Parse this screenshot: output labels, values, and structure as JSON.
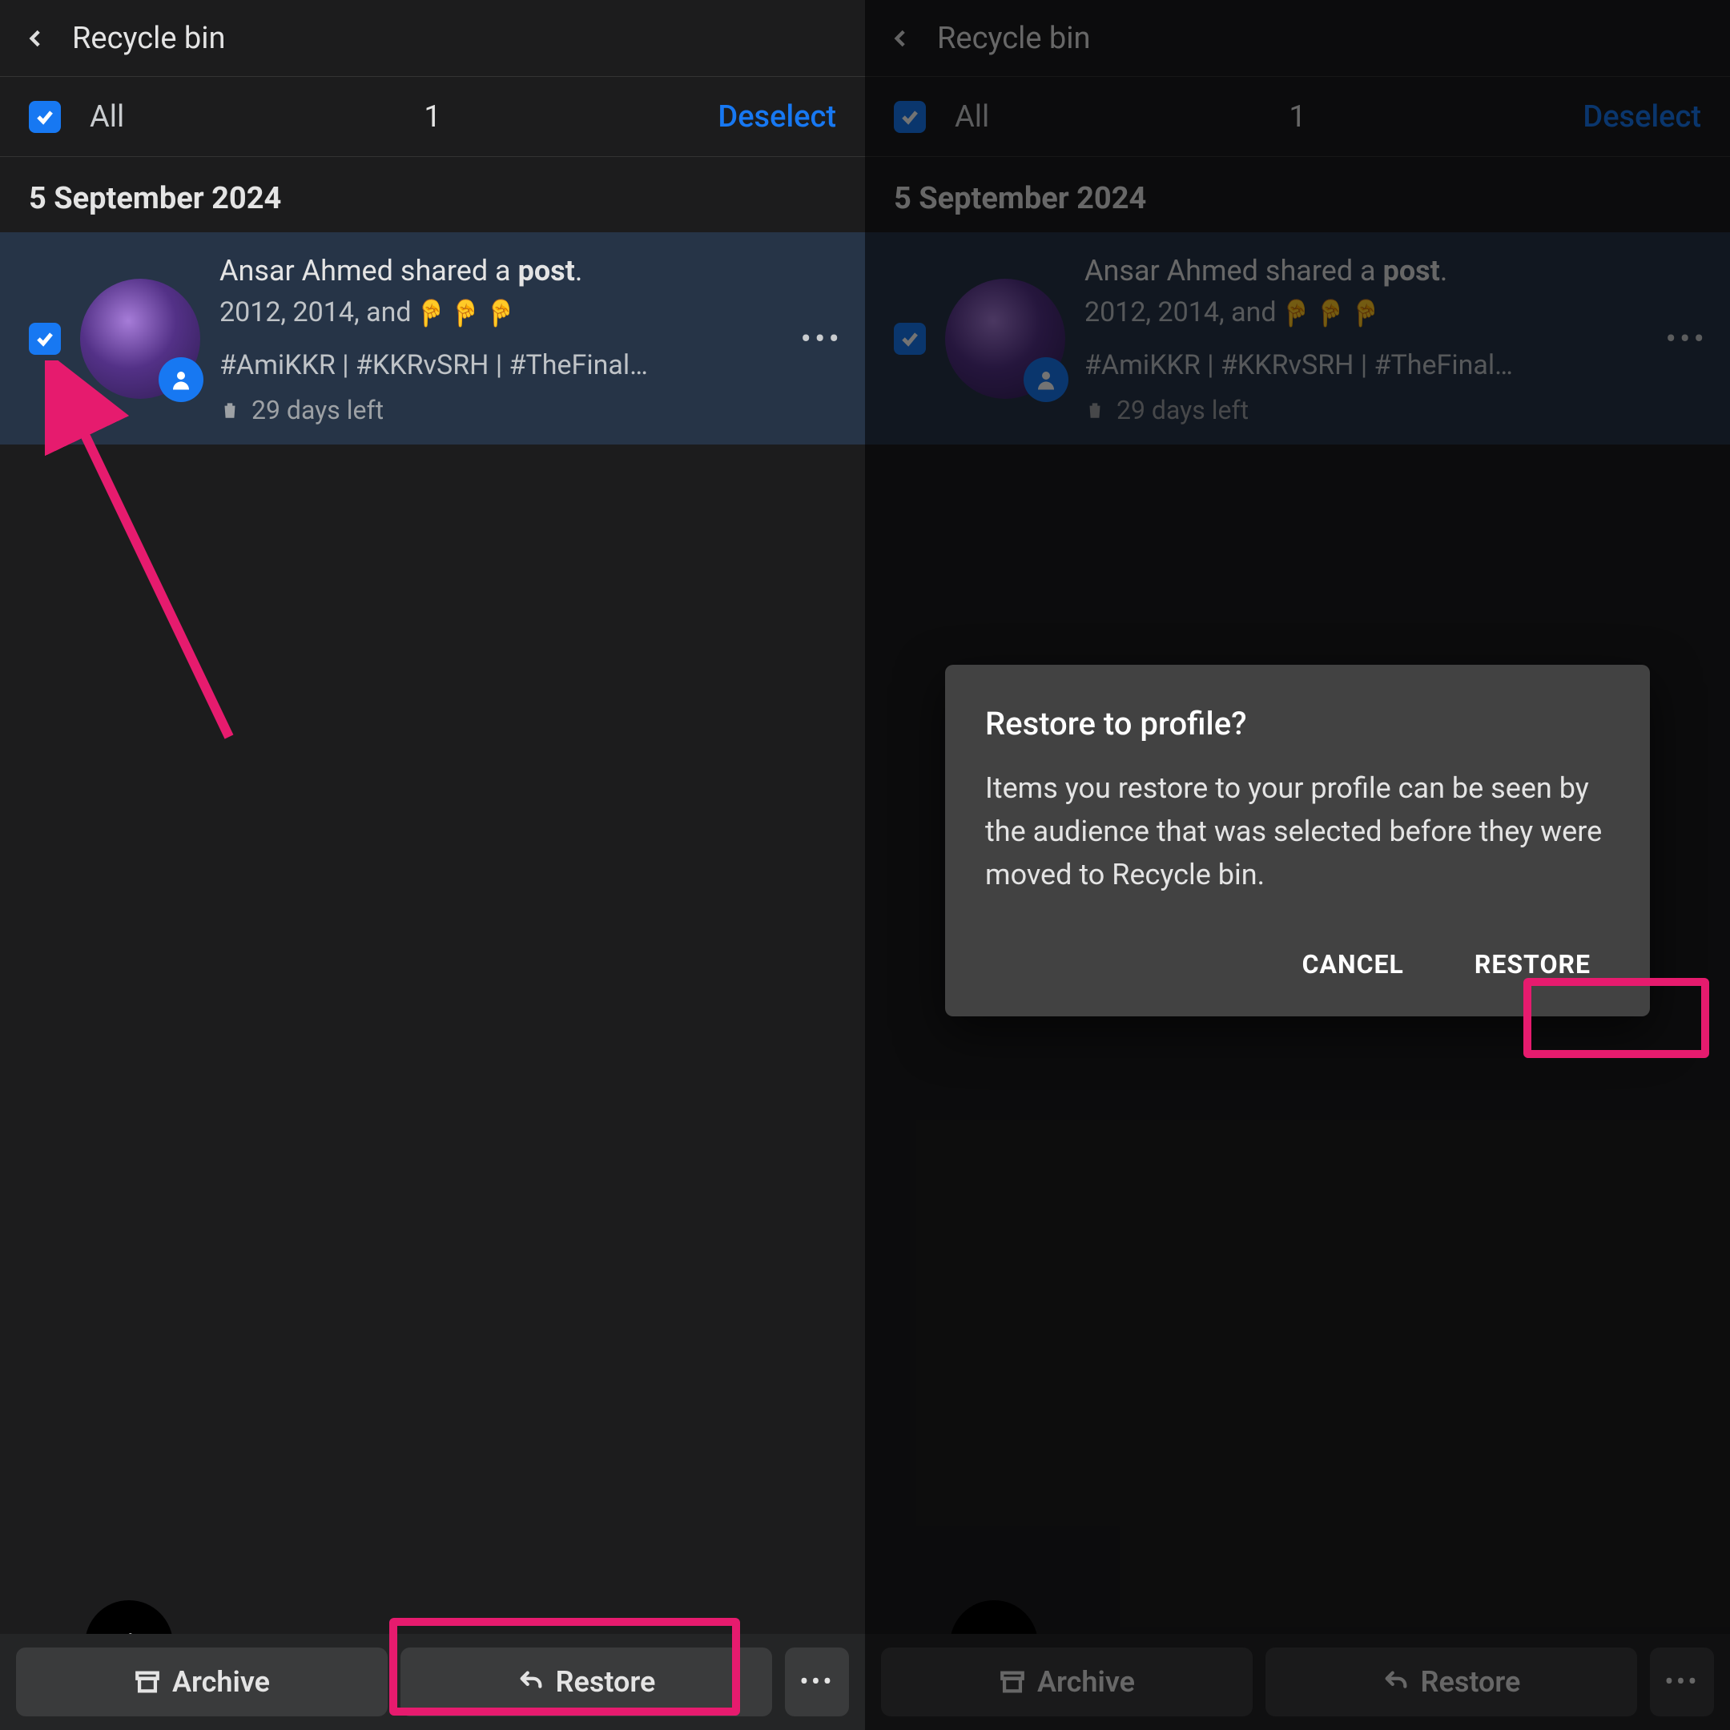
{
  "header": {
    "title": "Recycle bin"
  },
  "selection": {
    "all_label": "All",
    "count": "1",
    "deselect_label": "Deselect"
  },
  "date_header": "5 September 2024",
  "post": {
    "author": "Ansar Ahmed",
    "action_mid": " shared a ",
    "action_bold": "post",
    "action_suffix": ".",
    "line2_text": "2012, 2014, and ",
    "hashtags": "#AmiKKR | #KKRvSRH | #TheFinal…",
    "time_left": "29 days left"
  },
  "bottom": {
    "archive_label": "Archive",
    "restore_label": "Restore"
  },
  "dialog": {
    "title": "Restore to profile?",
    "body": "Items you restore to your profile can be seen by the audience that was selected before they were moved to Recycle bin.",
    "cancel": "CANCEL",
    "restore": "RESTORE"
  }
}
